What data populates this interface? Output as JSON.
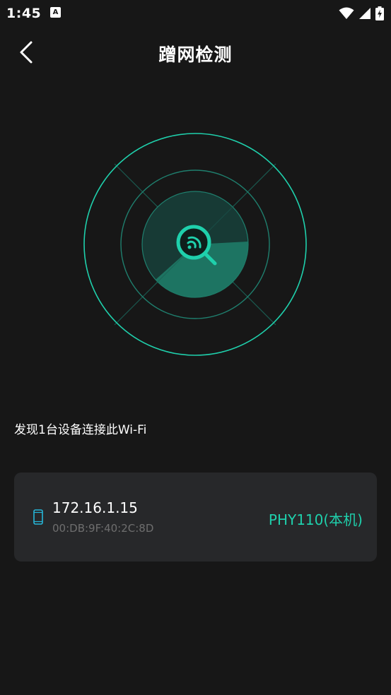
{
  "status_bar": {
    "time": "1:45",
    "app_icon_letter": "A",
    "icons": [
      "wifi-icon",
      "signal-icon",
      "battery-charging-icon"
    ]
  },
  "header": {
    "title": "蹭网检测",
    "back_icon": "chevron-left-icon"
  },
  "radar": {
    "center_icon": "wifi-search-icon",
    "accent_color": "#1fd0ac",
    "ring_color": "#1f7f6e"
  },
  "summary": {
    "found_text": "发现1台设备连接此Wi-Fi"
  },
  "devices": [
    {
      "ip": "172.16.1.15",
      "mac": "00:DB:9F:40:2C:8D",
      "name": "PHY110(本机)",
      "icon": "phone-icon"
    }
  ],
  "colors": {
    "background": "#171717",
    "card": "#27282a",
    "accent": "#1fd0ac"
  }
}
